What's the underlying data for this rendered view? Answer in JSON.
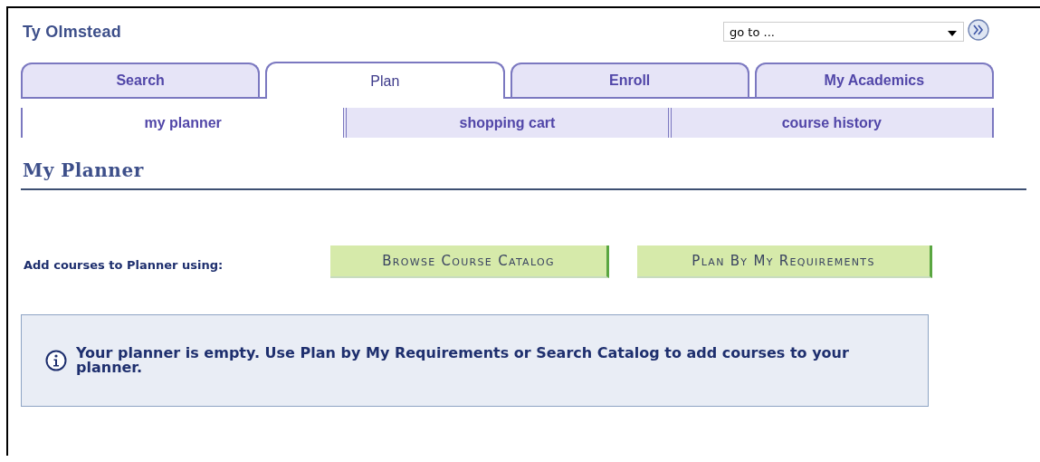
{
  "user_name": "Ty Olmstead",
  "goto": {
    "value": "go to ..."
  },
  "tabs": [
    {
      "label": "Search",
      "selected": false
    },
    {
      "label": "Plan",
      "selected": true
    },
    {
      "label": "Enroll",
      "selected": false
    },
    {
      "label": "My Academics",
      "selected": false
    }
  ],
  "subtabs": [
    {
      "label": "my planner",
      "selected": true
    },
    {
      "label": "shopping cart",
      "selected": false
    },
    {
      "label": "course history",
      "selected": false
    }
  ],
  "page_title": "My Planner",
  "add_label": "Add courses to Planner using:",
  "buttons": [
    "Browse Course Catalog",
    "Plan By My Requirements"
  ],
  "message": "Your planner is empty.  Use Plan by My Requirements or Search Catalog to add courses to your planner."
}
